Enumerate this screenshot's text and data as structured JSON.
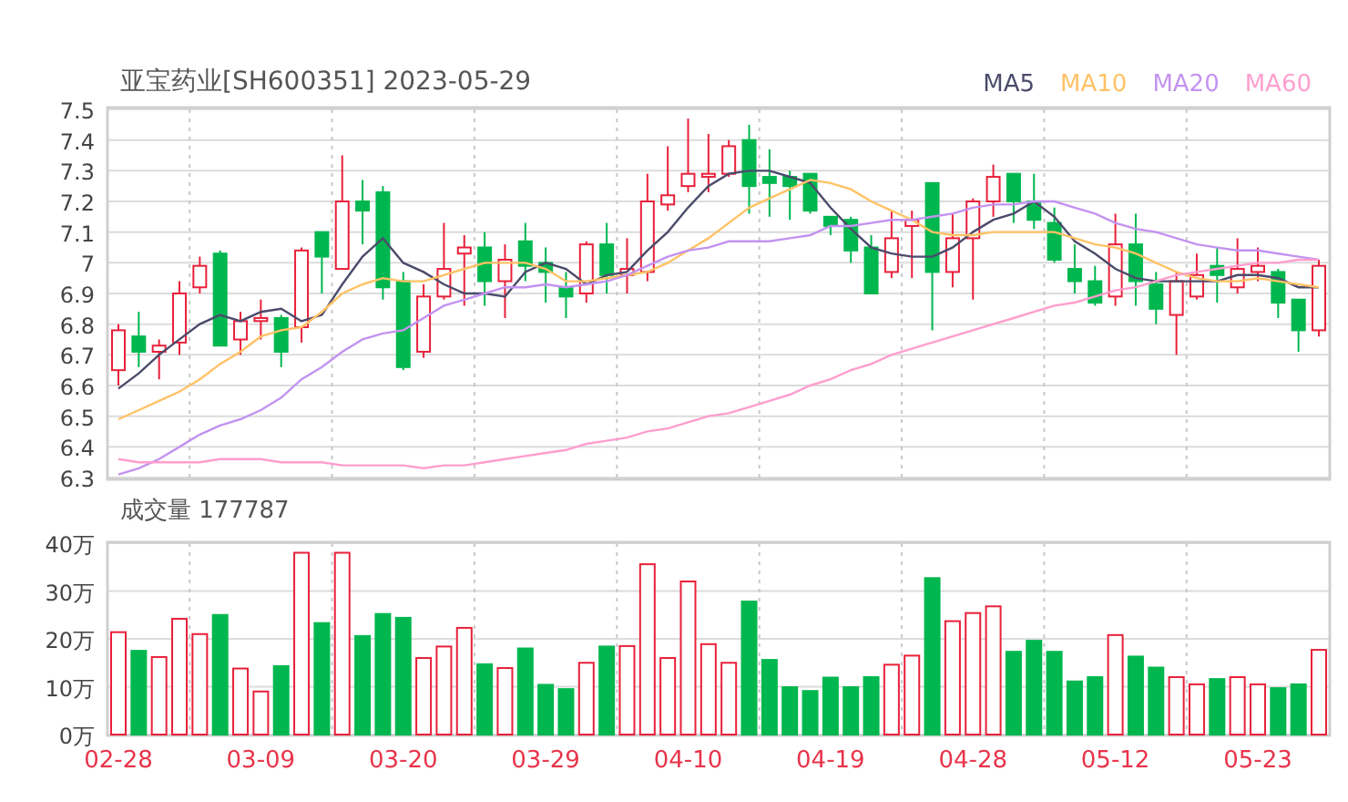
{
  "price_panel": {
    "title": "亚宝药业[SH600351] 2023-05-29",
    "candles": {
      "chart_data": {
        "type": "candlestick",
        "grid": true,
        "ylim": [
          6.3,
          7.5
        ],
        "yticks": [
          {
            "value": 7.5,
            "label": "7.5"
          },
          {
            "value": 7.4,
            "label": "7.4"
          },
          {
            "value": 7.3,
            "label": "7.3"
          },
          {
            "value": 7.2,
            "label": "7.2"
          },
          {
            "value": 7.1,
            "label": "7.1"
          },
          {
            "value": 7.0,
            "label": "7"
          },
          {
            "value": 6.9,
            "label": "6.9"
          },
          {
            "value": 6.8,
            "label": "6.8"
          },
          {
            "value": 6.7,
            "label": "6.7"
          },
          {
            "value": 6.6,
            "label": "6.6"
          },
          {
            "value": 6.5,
            "label": "6.5"
          },
          {
            "value": 6.4,
            "label": "6.4"
          },
          {
            "value": 6.3,
            "label": "6.3"
          }
        ],
        "categories": [
          null,
          null,
          null,
          null,
          null,
          null,
          null,
          null,
          null,
          null,
          null,
          null,
          null,
          null,
          null,
          null,
          null,
          null,
          null,
          null,
          null,
          null,
          null,
          null,
          null,
          null,
          null,
          null,
          null,
          null,
          null,
          null,
          null,
          null,
          null,
          null,
          null,
          null,
          null,
          null,
          null,
          null,
          null,
          null,
          null,
          null,
          null,
          null,
          null,
          null,
          null,
          null,
          null,
          null,
          null,
          null,
          null,
          null,
          null,
          null
        ],
        "ohlc": [
          [
            6.65,
            6.8,
            6.6,
            6.78
          ],
          [
            6.76,
            6.84,
            6.66,
            6.71
          ],
          [
            6.71,
            6.75,
            6.62,
            6.73
          ],
          [
            6.74,
            6.94,
            6.7,
            6.9
          ],
          [
            6.92,
            7.02,
            6.9,
            6.99
          ],
          [
            7.03,
            7.04,
            6.73,
            6.73
          ],
          [
            6.75,
            6.84,
            6.7,
            6.81
          ],
          [
            6.81,
            6.88,
            6.75,
            6.82
          ],
          [
            6.82,
            6.83,
            6.66,
            6.71
          ],
          [
            6.79,
            7.05,
            6.74,
            7.04
          ],
          [
            7.1,
            7.1,
            6.9,
            7.02
          ],
          [
            6.98,
            7.35,
            6.98,
            7.2
          ],
          [
            7.2,
            7.27,
            7.06,
            7.17
          ],
          [
            7.23,
            7.25,
            6.88,
            6.92
          ],
          [
            6.94,
            6.97,
            6.65,
            6.66
          ],
          [
            6.71,
            6.93,
            6.69,
            6.89
          ],
          [
            6.89,
            7.13,
            6.88,
            6.98
          ],
          [
            7.03,
            7.09,
            6.86,
            7.05
          ],
          [
            7.05,
            7.1,
            6.86,
            6.94
          ],
          [
            6.94,
            7.06,
            6.82,
            7.01
          ],
          [
            7.07,
            7.13,
            6.94,
            6.99
          ],
          [
            7.0,
            7.05,
            6.87,
            6.97
          ],
          [
            6.92,
            6.97,
            6.82,
            6.89
          ],
          [
            6.9,
            7.07,
            6.87,
            7.06
          ],
          [
            7.06,
            7.13,
            6.9,
            6.96
          ],
          [
            6.96,
            7.08,
            6.9,
            6.98
          ],
          [
            6.97,
            7.29,
            6.94,
            7.2
          ],
          [
            7.19,
            7.38,
            7.17,
            7.22
          ],
          [
            7.25,
            7.47,
            7.23,
            7.29
          ],
          [
            7.28,
            7.42,
            7.23,
            7.29
          ],
          [
            7.29,
            7.4,
            7.28,
            7.38
          ],
          [
            7.4,
            7.45,
            7.16,
            7.25
          ],
          [
            7.28,
            7.37,
            7.15,
            7.26
          ],
          [
            7.28,
            7.3,
            7.14,
            7.25
          ],
          [
            7.29,
            7.29,
            7.16,
            7.17
          ],
          [
            7.15,
            7.15,
            7.09,
            7.12
          ],
          [
            7.14,
            7.15,
            7.0,
            7.04
          ],
          [
            7.05,
            7.09,
            6.9,
            6.9
          ],
          [
            6.97,
            7.17,
            6.95,
            7.08
          ],
          [
            7.12,
            7.17,
            6.95,
            7.14
          ],
          [
            7.26,
            7.26,
            6.78,
            6.97
          ],
          [
            6.97,
            7.16,
            6.92,
            7.08
          ],
          [
            7.08,
            7.21,
            6.88,
            7.2
          ],
          [
            7.2,
            7.32,
            7.15,
            7.28
          ],
          [
            7.29,
            7.29,
            7.13,
            7.2
          ],
          [
            7.2,
            7.29,
            7.11,
            7.14
          ],
          [
            7.13,
            7.18,
            7.0,
            7.01
          ],
          [
            6.98,
            7.06,
            6.9,
            6.94
          ],
          [
            6.94,
            6.99,
            6.86,
            6.87
          ],
          [
            6.89,
            7.16,
            6.86,
            7.06
          ],
          [
            7.06,
            7.16,
            6.86,
            6.94
          ],
          [
            6.93,
            6.97,
            6.8,
            6.85
          ],
          [
            6.83,
            6.97,
            6.7,
            6.94
          ],
          [
            6.89,
            7.03,
            6.88,
            6.96
          ],
          [
            6.99,
            7.05,
            6.87,
            6.96
          ],
          [
            6.92,
            7.08,
            6.9,
            6.98
          ],
          [
            6.97,
            7.05,
            6.94,
            6.99
          ],
          [
            6.97,
            6.98,
            6.82,
            6.87
          ],
          [
            6.88,
            6.88,
            6.71,
            6.78
          ],
          [
            6.78,
            7.01,
            6.76,
            6.99
          ]
        ]
      }
    },
    "moving_averages": {
      "chart_data": {
        "type": "line",
        "ylim": [
          6.3,
          7.5
        ],
        "categories": [
          null,
          null,
          null,
          null,
          null,
          null,
          null,
          null,
          null,
          null,
          null,
          null,
          null,
          null,
          null,
          null,
          null,
          null,
          null,
          null,
          null,
          null,
          null,
          null,
          null,
          null,
          null,
          null,
          null,
          null,
          null,
          null,
          null,
          null,
          null,
          null,
          null,
          null,
          null,
          null,
          null,
          null,
          null,
          null,
          null,
          null,
          null,
          null,
          null,
          null,
          null,
          null,
          null,
          null,
          null,
          null,
          null,
          null,
          null,
          null
        ],
        "series": [
          {
            "name": "MA5",
            "color": "#4b4b6b",
            "values": [
              6.59,
              6.64,
              6.7,
              6.75,
              6.8,
              6.83,
              6.81,
              6.84,
              6.85,
              6.81,
              6.83,
              6.93,
              7.02,
              7.08,
              7.0,
              6.97,
              6.93,
              6.9,
              6.9,
              6.89,
              6.97,
              7.0,
              6.98,
              6.93,
              6.96,
              6.97,
              7.04,
              7.1,
              7.18,
              7.25,
              7.29,
              7.3,
              7.3,
              7.28,
              7.26,
              7.18,
              7.11,
              7.05,
              7.03,
              7.02,
              7.02,
              7.05,
              7.1,
              7.14,
              7.16,
              7.2,
              7.15,
              7.07,
              7.03,
              6.98,
              6.95,
              6.94,
              6.94,
              6.94,
              6.94,
              6.96,
              6.96,
              6.95,
              6.92,
              6.92
            ]
          },
          {
            "name": "MA10",
            "color": "#ffc266",
            "values": [
              6.49,
              6.52,
              6.55,
              6.58,
              6.62,
              6.67,
              6.71,
              6.76,
              6.78,
              6.79,
              6.84,
              6.9,
              6.93,
              6.95,
              6.94,
              6.94,
              6.96,
              6.98,
              7.0,
              7.0,
              7.0,
              6.98,
              6.94,
              6.94,
              6.95,
              6.96,
              6.97,
              7.0,
              7.04,
              7.08,
              7.13,
              7.18,
              7.21,
              7.24,
              7.27,
              7.26,
              7.24,
              7.2,
              7.17,
              7.14,
              7.1,
              7.09,
              7.09,
              7.1,
              7.1,
              7.1,
              7.1,
              7.08,
              7.06,
              7.05,
              7.03,
              7.0,
              6.97,
              6.95,
              6.94,
              6.94,
              6.95,
              6.94,
              6.93,
              6.92
            ]
          },
          {
            "name": "MA20",
            "color": "#c393f0",
            "values": [
              6.31,
              6.33,
              6.36,
              6.4,
              6.44,
              6.47,
              6.49,
              6.52,
              6.56,
              6.62,
              6.66,
              6.71,
              6.75,
              6.77,
              6.78,
              6.82,
              6.86,
              6.88,
              6.9,
              6.92,
              6.92,
              6.93,
              6.92,
              6.93,
              6.94,
              6.96,
              6.99,
              7.02,
              7.04,
              7.05,
              7.07,
              7.07,
              7.07,
              7.08,
              7.09,
              7.12,
              7.12,
              7.13,
              7.14,
              7.14,
              7.15,
              7.16,
              7.18,
              7.19,
              7.19,
              7.2,
              7.2,
              7.18,
              7.16,
              7.13,
              7.11,
              7.1,
              7.08,
              7.06,
              7.05,
              7.04,
              7.04,
              7.03,
              7.02,
              7.01
            ]
          },
          {
            "name": "MA60",
            "color": "#ff9ecf",
            "values": [
              6.36,
              6.35,
              6.35,
              6.35,
              6.35,
              6.36,
              6.36,
              6.36,
              6.35,
              6.35,
              6.35,
              6.34,
              6.34,
              6.34,
              6.34,
              6.33,
              6.34,
              6.34,
              6.35,
              6.36,
              6.37,
              6.38,
              6.39,
              6.41,
              6.42,
              6.43,
              6.45,
              6.46,
              6.48,
              6.5,
              6.51,
              6.53,
              6.55,
              6.57,
              6.6,
              6.62,
              6.65,
              6.67,
              6.7,
              6.72,
              6.74,
              6.76,
              6.78,
              6.8,
              6.82,
              6.84,
              6.86,
              6.87,
              6.89,
              6.91,
              6.92,
              6.94,
              6.96,
              6.97,
              6.98,
              6.99,
              7.0,
              7.0,
              7.01,
              7.01
            ]
          }
        ]
      }
    }
  },
  "volume_panel": {
    "title": "成交量 177787",
    "chart_data": {
      "type": "bar",
      "grid": true,
      "ylim": [
        0,
        40
      ],
      "categories": [
        "02-28",
        null,
        null,
        null,
        null,
        null,
        null,
        "03-09",
        null,
        null,
        null,
        null,
        null,
        null,
        "03-20",
        null,
        null,
        null,
        null,
        null,
        null,
        "03-29",
        null,
        null,
        null,
        null,
        null,
        null,
        "04-10",
        null,
        null,
        null,
        null,
        null,
        null,
        "04-19",
        null,
        null,
        null,
        null,
        null,
        null,
        "04-28",
        null,
        null,
        null,
        null,
        null,
        null,
        "05-12",
        null,
        null,
        null,
        null,
        null,
        null,
        "05-23",
        null,
        null,
        null
      ],
      "yticks": [
        {
          "value": 40,
          "label": "40万"
        },
        {
          "value": 30,
          "label": "30万"
        },
        {
          "value": 20,
          "label": "20万"
        },
        {
          "value": 10,
          "label": "10万"
        },
        {
          "value": 0,
          "label": "0万"
        }
      ],
      "values": [
        21.4,
        17.5,
        16.2,
        24.2,
        21.0,
        25.0,
        13.8,
        9.0,
        14.3,
        38.0,
        23.3,
        38.0,
        20.6,
        25.2,
        24.4,
        16.0,
        18.4,
        22.3,
        14.7,
        13.9,
        18.0,
        10.4,
        9.5,
        15.0,
        18.4,
        18.5,
        35.6,
        16.0,
        32.0,
        18.9,
        15.0,
        27.8,
        15.6,
        9.9,
        9.1,
        11.9,
        9.9,
        12.0,
        14.6,
        16.5,
        32.7,
        23.7,
        25.4,
        26.8,
        17.3,
        19.6,
        17.3,
        11.1,
        12.0,
        20.8,
        16.3,
        14.0,
        12.0,
        10.5,
        11.6,
        12.0,
        10.5,
        9.7,
        10.5,
        17.7
      ]
    }
  }
}
